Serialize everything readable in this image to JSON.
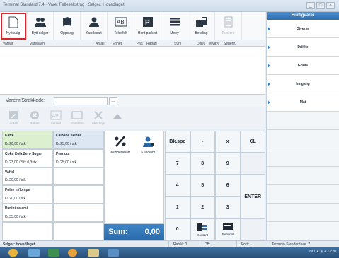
{
  "window": {
    "title": "Terminal Standard 7.4 · Vare: Fellesekstrag · Selger: Hovedlaget",
    "buttons": [
      "_",
      "□",
      "×"
    ]
  },
  "toolbar": [
    {
      "label": "Nytt salg",
      "icon": "new-document-icon",
      "active": true
    },
    {
      "label": "Bytt selger",
      "icon": "users-icon"
    },
    {
      "label": "Oppslag",
      "icon": "book-icon"
    },
    {
      "label": "Kundesalt",
      "icon": "person-icon"
    },
    {
      "label": "Tekstfelt",
      "icon": "text-field-icon"
    },
    {
      "label": "Hent parkert",
      "icon": "parking-icon"
    },
    {
      "label": "Meny",
      "icon": "menu-icon"
    },
    {
      "label": "Betaling",
      "icon": "payment-icon"
    },
    {
      "label": "Ta ordre",
      "icon": "order-icon",
      "disabled": true
    }
  ],
  "columns": [
    "Varenr",
    "Varenavn",
    "Antall",
    "Enhet",
    "Pris",
    "Rabatt",
    "Sum",
    "Dis%",
    "Mva%",
    "Serienr."
  ],
  "varenr": {
    "label": "Varenr/Strekkode:",
    "value": "",
    "lookup_label": "..."
  },
  "actions": [
    {
      "label": "Antall",
      "icon": "edit-icon"
    },
    {
      "label": "Rabatt",
      "icon": "discount-icon"
    },
    {
      "label": "Serienr",
      "icon": "serial-icon"
    },
    {
      "label": "Vareliste",
      "icon": "list-icon"
    },
    {
      "label": "Slett linje",
      "icon": "delete-icon"
    }
  ],
  "products": [
    {
      "name": "Kaffe",
      "price": "Kr.20,00 / stk.",
      "color": "green"
    },
    {
      "name": "Calzone skinke",
      "price": "Kr.25,00 / stk.",
      "color": "blue"
    },
    {
      "name": "Coka Cola Zero Sugar",
      "price": "Kr.23,00 / Stk.0,3stk.",
      "color": "white"
    },
    {
      "name": "Peanuts",
      "price": "Kr.25,00 / stk.",
      "color": "white"
    },
    {
      "name": "Vaffel",
      "price": "Kr.20,00 / stk.",
      "color": "white"
    },
    {
      "name": "",
      "price": "",
      "color": "white"
    },
    {
      "name": "Pølse m/lompe",
      "price": "Kr.20,00 / stk.",
      "color": "white"
    },
    {
      "name": "",
      "price": "",
      "color": "white"
    },
    {
      "name": "Panini salami",
      "price": "Kr.35,00 / stk.",
      "color": "white"
    },
    {
      "name": "",
      "price": "",
      "color": "white"
    },
    {
      "name": "",
      "price": "",
      "color": "white"
    },
    {
      "name": "",
      "price": "",
      "color": "white"
    }
  ],
  "discount": {
    "kunderabatt": "Kunderabatt",
    "kundeinfo": "Kundeinf."
  },
  "sum": {
    "label": "Sum:",
    "value": "0,00"
  },
  "keypad": {
    "bkspc": "Bk.spc",
    "minus": "-",
    "times": "x",
    "cl": "CL",
    "k7": "7",
    "k8": "8",
    "k9": "9",
    "k4": "4",
    "k5": "5",
    "k6": "6",
    "k1": "1",
    "k2": "2",
    "k3": "3",
    "k0": "0",
    "kontant": "Kontant",
    "terminal": "Terminal",
    "enter": "ENTER"
  },
  "quick": {
    "header": "Hurtigvarer",
    "items": [
      "Diverse",
      "Drikke",
      "Godis",
      "Inngang",
      "Mat"
    ]
  },
  "status": {
    "seller": "Selger: Hovedlaget",
    "rabatt": "Rab%: 0",
    "db": "DB: -",
    "fortj": "Fortj: -",
    "version": "Terminal Standard ver. 7"
  },
  "taskbar": {
    "tray": "NO  ▲  ⊞  ◐  17:20"
  }
}
